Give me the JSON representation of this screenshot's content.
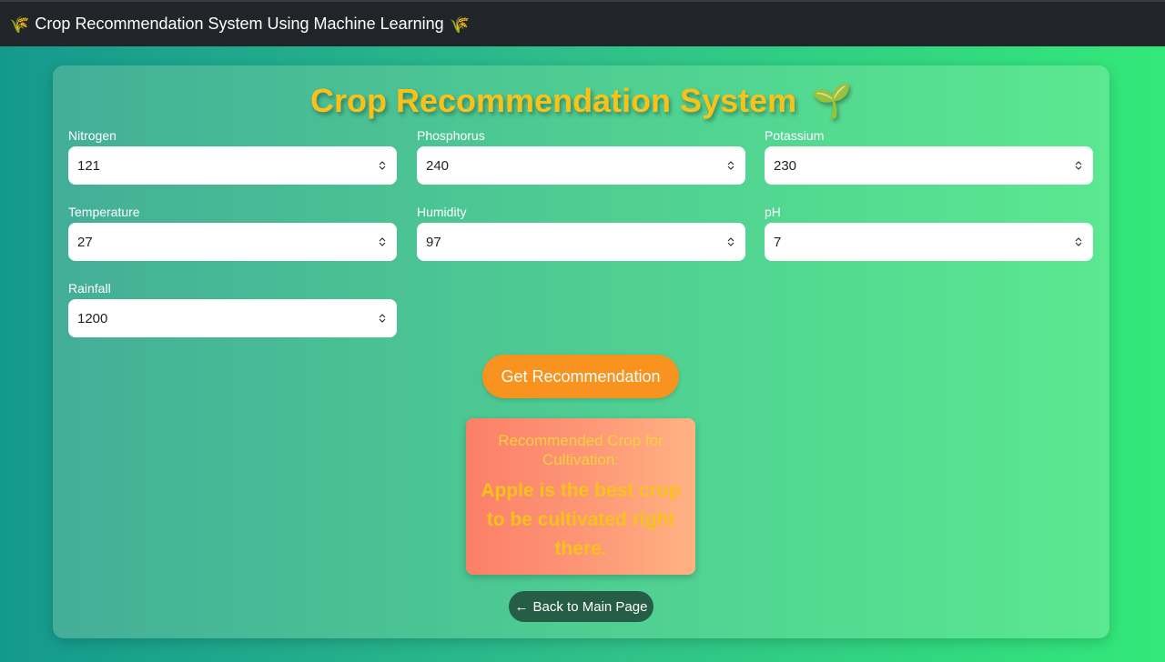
{
  "navbar": {
    "icon_left": "🌾",
    "title": "Crop Recommendation System Using Machine Learning",
    "icon_right": "🌾"
  },
  "main": {
    "title": "Crop Recommendation System",
    "title_icon": "🌱",
    "fields": [
      {
        "label": "Nitrogen",
        "value": "121"
      },
      {
        "label": "Phosphorus",
        "value": "240"
      },
      {
        "label": "Potassium",
        "value": "230"
      },
      {
        "label": "Temperature",
        "value": "27"
      },
      {
        "label": "Humidity",
        "value": "97"
      },
      {
        "label": "pH",
        "value": "7"
      },
      {
        "label": "Rainfall",
        "value": "1200"
      }
    ],
    "submit_label": "Get Recommendation",
    "result": {
      "heading": "Recommended Crop for Cultivation:",
      "text": "Apple is the best crop to be cultivated right there."
    },
    "back_arrow": "←",
    "back_label": "Back to Main Page"
  }
}
